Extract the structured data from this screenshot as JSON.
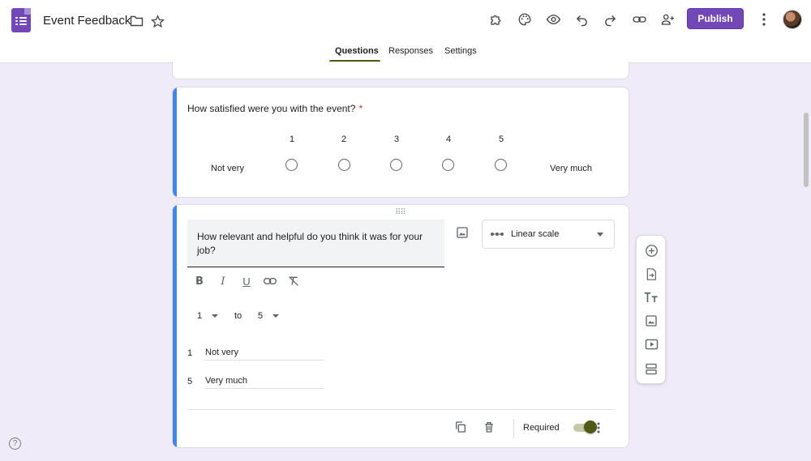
{
  "header": {
    "title": "Event Feedback",
    "publish_label": "Publish"
  },
  "tabs": [
    {
      "label": "Questions",
      "active": true
    },
    {
      "label": "Responses",
      "active": false
    },
    {
      "label": "Settings",
      "active": false
    }
  ],
  "questions": [
    {
      "title": "How satisfied were you with the event?",
      "required_mark": "*",
      "scale": [
        "1",
        "2",
        "3",
        "4",
        "5"
      ],
      "low_label": "Not very",
      "high_label": "Very much"
    },
    {
      "title": "How relevant and helpful do you think it was for your job?",
      "type_label": "Linear scale",
      "range_from": "1",
      "range_to_word": "to",
      "range_to": "5",
      "label_low_num": "1",
      "label_low_value": "Not very",
      "label_high_num": "5",
      "label_high_value": "Very much",
      "required_label": "Required",
      "required_on": true
    }
  ],
  "help": "?",
  "colors": {
    "accent": "#4285f4",
    "brand": "#7248b9",
    "toggle": "#4f5a17",
    "background": "#f0ebf8"
  }
}
